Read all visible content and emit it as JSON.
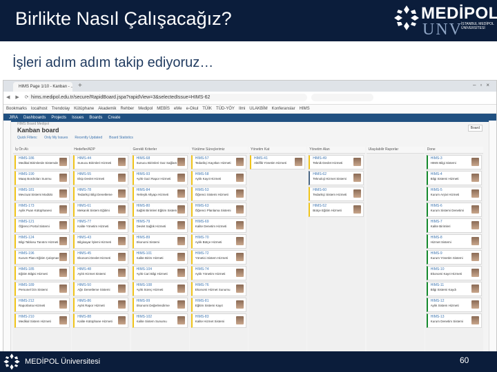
{
  "slide": {
    "title": "Birlikte Nasıl Çalışacağız?",
    "subtitle": "İşleri adım adım takip ediyoruz…",
    "footer_text": "MEDİPOL Üniversitesi",
    "page_number": "60"
  },
  "logo": {
    "brand": "MEDİPOL",
    "unv": "UNV",
    "sub": "İSTANBUL MEDİPOL ÜNİVERSİTESİ"
  },
  "colors": {
    "navy": "#0b1d3b",
    "jira_blue": "#205081",
    "link_blue": "#3b73af"
  },
  "browser": {
    "tab_label": "HIMS Page 1/10 - Kanban - ...",
    "url": "hims.medipol.edu.tr/secure/RapidBoard.jspa?rapidView=3&selectedIssue=HIMS-62",
    "bookmarks": [
      "Bookmarks",
      "localhost",
      "Trendolay",
      "Kütüphane",
      "Akademik",
      "Rehber",
      "Medipol",
      "MEBİS",
      "eMe",
      "e-Okul",
      "TÜİK",
      "TÜD-YÖY",
      "Ilmi",
      "ULAKBİM",
      "Konferanslar",
      "HIMS"
    ],
    "jira_menu": [
      "JIRA",
      "Dashboards",
      "Projects",
      "Issues",
      "Boards",
      "Create"
    ]
  },
  "board": {
    "project": "HIMS Board Medipol",
    "title": "Kanban board",
    "quick_filters": [
      "Quick Filters:",
      "Only My Issues",
      "Recently Updated",
      "Board Statistics"
    ],
    "board_button": "Board",
    "columns": [
      {
        "name": "İş Ön Alı",
        "cards": [
          {
            "key": "HIMS-186",
            "summary": "Medikal Birimlerde Sistemde",
            "color": "yellow"
          },
          {
            "key": "HIMS-190",
            "summary": "Maaş Bordroları Sunmu",
            "color": "yellow"
          },
          {
            "key": "HIMS-181",
            "summary": "Mevzuat Sistemi Modülü",
            "color": "yellow"
          },
          {
            "key": "HIMS-173",
            "summary": "Aylık Puan Kütüphanesi",
            "color": "yellow"
          },
          {
            "key": "HIMS-121",
            "summary": "Öğrenci Portal Sistemi",
            "color": "yellow"
          },
          {
            "key": "HIMS-124",
            "summary": "Bilgi Tablosu Tanıtım Hizmeti",
            "color": "yellow"
          },
          {
            "key": "HIMS-196",
            "summary": "Kurum Planı Eğitim Çalışması",
            "color": "yellow"
          },
          {
            "key": "HIMS-185",
            "summary": "Eğitim Bilgisi Hizmeti",
            "color": "yellow"
          },
          {
            "key": "HIMS-189",
            "summary": "Personel İzin Sistemi",
            "color": "yellow"
          },
          {
            "key": "HIMS-212",
            "summary": "Raporlama Hizmeti",
            "color": "yellow"
          },
          {
            "key": "HIMS-210",
            "summary": "Medikal Sistem Hizmeti",
            "color": "yellow"
          }
        ]
      },
      {
        "name": "Hedefler/ADP",
        "cards": [
          {
            "key": "HIMS-44",
            "summary": "Sunucu Birimleri Hizmeti",
            "color": "yellow"
          },
          {
            "key": "HIMS-55",
            "summary": "Ekip Devlet Hizmeti",
            "color": "yellow"
          },
          {
            "key": "HIMS-78",
            "summary": "Tedarikçi Bilgi Denetleme",
            "color": "yellow"
          },
          {
            "key": "HIMS-61",
            "summary": "Mekanik Sistem Eğitimi",
            "color": "yellow"
          },
          {
            "key": "HIMS-77",
            "summary": "Kalite Yönetim Hizmeti",
            "color": "yellow"
          },
          {
            "key": "HIMS-43",
            "summary": "Bilgisayar İşlemi Hizmeti",
            "color": "yellow"
          },
          {
            "key": "HIMS-45",
            "summary": "Ekonomi Devlet Hizmeti",
            "color": "yellow"
          },
          {
            "key": "HIMS-48",
            "summary": "Aylık Hizmet Sistemi",
            "color": "yellow"
          },
          {
            "key": "HIMS-50",
            "summary": "Ağrı Denetleme Sistemi",
            "color": "yellow"
          },
          {
            "key": "HIMS-86",
            "summary": "Aylık Rapor Hizmeti",
            "color": "yellow"
          },
          {
            "key": "HIMS-88",
            "summary": "Kalite Kütüphane Hizmeti",
            "color": "yellow"
          }
        ]
      },
      {
        "name": "Gerekli Kriterler",
        "cards": [
          {
            "key": "HIMS-68",
            "summary": "Sunucu Birimleri Gaz Sağlam",
            "color": "yellow"
          },
          {
            "key": "HIMS-93",
            "summary": "Aylık Gazi Rapor Hizmeti",
            "color": "yellow"
          },
          {
            "key": "HIMS-84",
            "summary": "Yerleşik Altyapı Hizmeti",
            "color": "yellow"
          },
          {
            "key": "HIMS-80",
            "summary": "Sağlık Birimleri Eğitim Sistemi",
            "color": "yellow"
          },
          {
            "key": "HIMS-79",
            "summary": "Devlet Sağlık Hizmeti",
            "color": "yellow"
          },
          {
            "key": "HIMS-89",
            "summary": "Ekonomi Sistemi",
            "color": "yellow"
          },
          {
            "key": "HIMS-101",
            "summary": "Kalite Birim Hizmeti",
            "color": "yellow"
          },
          {
            "key": "HIMS-104",
            "summary": "Aylık Cari Bilgi Hizmeti",
            "color": "yellow"
          },
          {
            "key": "HIMS-108",
            "summary": "Aylık Süreç Hizmeti",
            "color": "yellow"
          },
          {
            "key": "HIMS-99",
            "summary": "Ekonomi Değerlendirme",
            "color": "yellow"
          },
          {
            "key": "HIMS-102",
            "summary": "Kalite Sistem Sunumu",
            "color": "yellow"
          }
        ]
      },
      {
        "name": "Yürütme Süreçlerimiz",
        "cards": [
          {
            "key": "HIMS-57",
            "summary": "Tedarikçi Kayıtları Hizmeti",
            "color": "yellow"
          },
          {
            "key": "HIMS-58",
            "summary": "Aylık Kayıt Hizmeti",
            "color": "yellow"
          },
          {
            "key": "HIMS-53",
            "summary": "Öğrenci Sistemi Hizmeti",
            "color": "yellow"
          },
          {
            "key": "HIMS-63",
            "summary": "Öğrenci Planlama Sistemi",
            "color": "yellow"
          },
          {
            "key": "HIMS-69",
            "summary": "Kalite Denetim Hizmeti",
            "color": "yellow"
          },
          {
            "key": "HIMS-70",
            "summary": "Aylık Bütçe Hizmeti",
            "color": "yellow"
          },
          {
            "key": "HIMS-72",
            "summary": "Yönetici Sistem Hizmeti",
            "color": "yellow"
          },
          {
            "key": "HIMS-74",
            "summary": "Aylık Yönetim Hizmeti",
            "color": "yellow"
          },
          {
            "key": "HIMS-76",
            "summary": "Ekonomi Hizmet Sunumu",
            "color": "yellow"
          },
          {
            "key": "HIMS-81",
            "summary": "Eğitim Sistemi Kayıt",
            "color": "yellow"
          },
          {
            "key": "HIMS-83",
            "summary": "Kalite Hizmet Sistemi",
            "color": "yellow"
          }
        ]
      },
      {
        "name": "Yönetim Kat",
        "cards": [
          {
            "key": "HIMS-41",
            "summary": "Aktiflik Yönetim Hizmeti",
            "color": "yellow"
          }
        ]
      },
      {
        "name": "Yönetim Alan",
        "cards": [
          {
            "key": "HIMS-49",
            "summary": "Teknik Devlet Hizmeti",
            "color": "yellow"
          },
          {
            "key": "HIMS-62",
            "summary": "Teknoloji Hizmet Sistemi",
            "color": "blue"
          },
          {
            "key": "HIMS-60",
            "summary": "Tedarikçi Sistem Hizmeti",
            "color": "yellow"
          },
          {
            "key": "HIMS-52",
            "summary": "Bütçe Eğitim Hizmeti",
            "color": "yellow"
          }
        ]
      },
      {
        "name": "Ulaşılabilir Raporlar",
        "cards": []
      },
      {
        "name": "Done",
        "cards": [
          {
            "key": "HIMS-3",
            "summary": "HIMS Bilgi Sistemi",
            "color": "green"
          },
          {
            "key": "HIMS-4",
            "summary": "Bilgi Sistemi Hizmeti",
            "color": "green"
          },
          {
            "key": "HIMS-5",
            "summary": "Kurum Arşivi Hizmeti",
            "color": "green"
          },
          {
            "key": "HIMS-6",
            "summary": "Kurum Sistemi Denetimi",
            "color": "green"
          },
          {
            "key": "HIMS-7",
            "summary": "Kalite Birimleri",
            "color": "green"
          },
          {
            "key": "HIMS-8",
            "summary": "Hizmet Sistemi",
            "color": "green"
          },
          {
            "key": "HIMS-9",
            "summary": "Kurum Yönetim Sistemi",
            "color": "green"
          },
          {
            "key": "HIMS-10",
            "summary": "Ekonomi Kayıt Hizmeti",
            "color": "green"
          },
          {
            "key": "HIMS-11",
            "summary": "Bilgi Sistemi Kaydı",
            "color": "green"
          },
          {
            "key": "HIMS-12",
            "summary": "Aylık Sistem Hizmeti",
            "color": "green"
          },
          {
            "key": "HIMS-13",
            "summary": "Kurum Denetim Sistemi",
            "color": "green"
          }
        ]
      }
    ]
  }
}
